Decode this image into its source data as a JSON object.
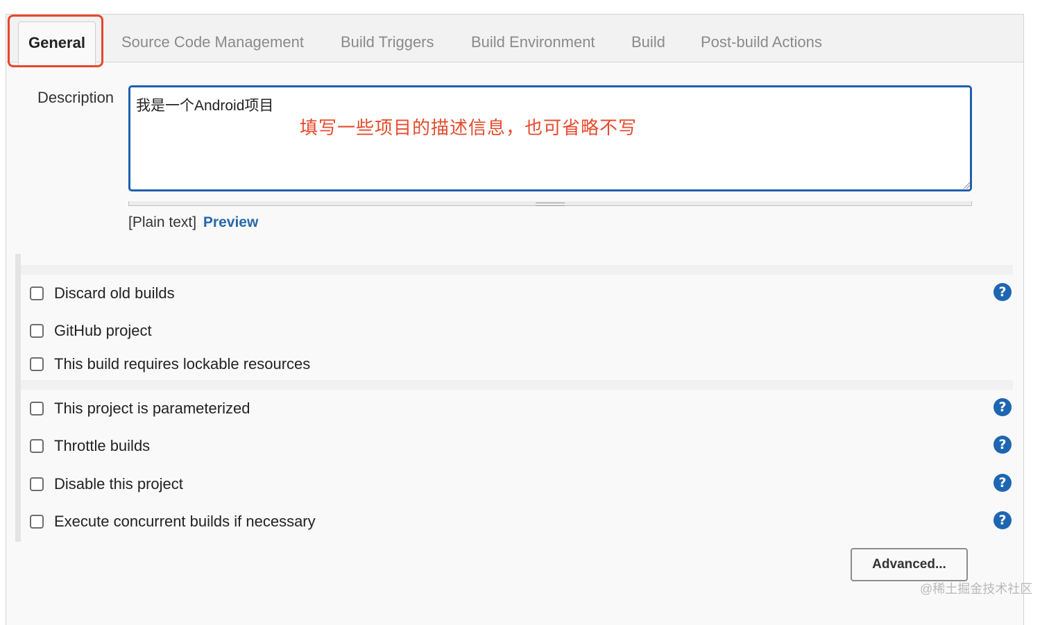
{
  "tabs": [
    {
      "label": "General"
    },
    {
      "label": "Source Code Management"
    },
    {
      "label": "Build Triggers"
    },
    {
      "label": "Build Environment"
    },
    {
      "label": "Build"
    },
    {
      "label": "Post-build Actions"
    }
  ],
  "description": {
    "label": "Description",
    "value": "我是一个Android项目",
    "annotation": "填写一些项目的描述信息，也可省略不写"
  },
  "format": {
    "plain_text": "[Plain text]",
    "preview": "Preview"
  },
  "options": [
    {
      "label": "Discard old builds"
    },
    {
      "label": "GitHub project"
    },
    {
      "label": "This build requires lockable resources"
    },
    {
      "label": "This project is parameterized"
    },
    {
      "label": "Throttle builds"
    },
    {
      "label": "Disable this project"
    },
    {
      "label": "Execute concurrent builds if necessary"
    }
  ],
  "help_icon": "?",
  "advanced_button": "Advanced...",
  "watermark": "@稀土掘金技术社区",
  "colors": {
    "highlight": "#e8452c",
    "link": "#2768aa",
    "focus_border": "#1d5fb0",
    "help_icon": "#1f66b1"
  }
}
